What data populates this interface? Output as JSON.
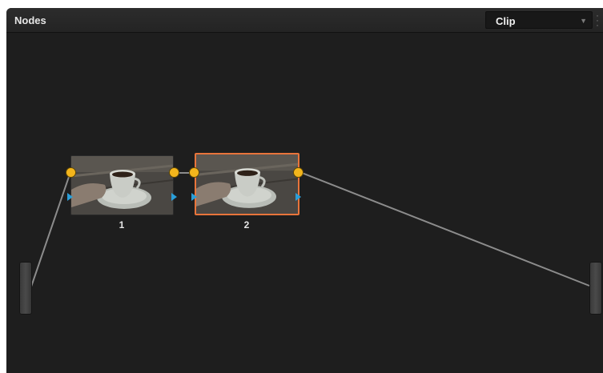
{
  "panel": {
    "title": "Nodes",
    "mode_select": {
      "value": "Clip"
    }
  },
  "nodes": [
    {
      "label": "1",
      "selected": false
    },
    {
      "label": "2",
      "selected": true
    }
  ],
  "colors": {
    "panel_bg": "#1e1e1e",
    "selected_outline": "#e8743b",
    "rgb_port": "#f3b51c",
    "key_port": "#2a9ed8",
    "connection_line": "#8c8c8c"
  },
  "icons": {
    "rgb_port": "yellow-circle",
    "key_port": "blue-triangle",
    "dropdown": "chevron-down",
    "panel_menu": "vertical-dots"
  }
}
